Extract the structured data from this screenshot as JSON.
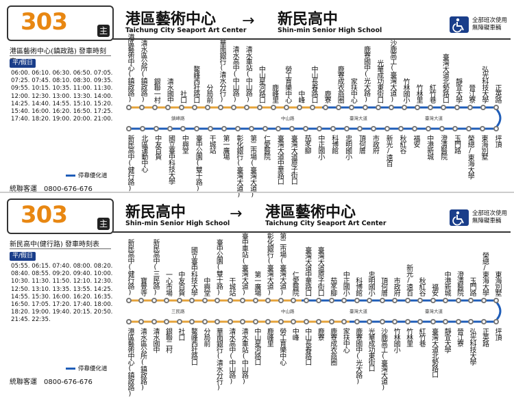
{
  "colors": {
    "route_number": "#e88712",
    "orange_line": "#e5a33a",
    "blue_line": "#1f5db8",
    "accent": "#1a3e8a"
  },
  "icons": {
    "main": "main-badge",
    "accessible": "wheelchair-icon"
  },
  "panels": [
    {
      "route": "303",
      "badge": "主",
      "from_zh": "港區藝術中心",
      "from_en": "Taichung City Seaport Art Center",
      "to_zh": "新民高中",
      "to_en": "Shin-min Senior High School",
      "arrow": "→",
      "access_text1": "全部班次使用",
      "access_text2": "無障礙車輛",
      "schedule_title": "港區藝術中心(鎮政路) 發車時刻表",
      "day_type": "平/假日",
      "times": [
        "06:00. 06:10. 06:30. 06:50. 07:05.",
        "07:25. 07:45. 08:10. 08:30. 09:35.",
        "09:55. 10:15. 10:35. 11:00. 11:30.",
        "12:00. 12:30. 13:00. 13:30. 14:00.",
        "14:25. 14:40. 14:55. 15:10. 15:20.",
        "15:40. 16:00. 16:20. 16:50. 17:25.",
        "17:40. 18:20. 19:00. 20:00. 21:00."
      ],
      "legend": "停靠優化道",
      "contact": "統聯客運　0800-676-676",
      "roads": [
        "鎮峰路",
        "中山路",
        "臺灣大道",
        "臺灣大道"
      ],
      "top_stops": [
        "港區藝術中心(鎮政路)",
        "清水區公所(鎮政路)",
        "銀聯一村",
        "清水國中",
        "社口",
        "鰲峰西社路口",
        "分局前",
        "華南銀行(清水分行)",
        "清水高中(中山路)",
        "清水車站(中山路)",
        "中山星河路口",
        "鹿峰里",
        "勞工育樂中心",
        "中峰",
        "中山長春路口",
        "鹿寮",
        "鹿寮成衣商圈",
        "家扶中心",
        "鹿寮國中(光大路)",
        "光華成功東街口",
        "沙鹿高工(臺灣大道)",
        "竹林國小",
        "竹林里",
        "紅竹巷",
        "臺灣大道北勢路口",
        "靜宜大學",
        "晉江寮",
        "弘光科技大學",
        "正英路"
      ],
      "bottom_stops": [
        "新民高中(健行路)",
        "北區運動中心",
        "中友百貨",
        "國立臺中科技大學",
        "中興堂",
        "臺中公園(雙十路)",
        "干城站",
        "第一廣場",
        "彰化銀行(臺灣大道)",
        "第二市場(臺灣大道)",
        "仁愛醫院",
        "臺灣大道中華路口",
        "臺灣大道原子街口",
        "茄苳腳",
        "中正國小",
        "科博館",
        "忠明國小",
        "頂何厝",
        "市政府",
        "新光/遠百",
        "秋紅谷",
        "福安",
        "中港新城",
        "澄清醫院",
        "玉門路",
        "榮總/東海大學",
        "東海別墅",
        "坪頂"
      ]
    },
    {
      "route": "303",
      "badge": "主",
      "from_zh": "新民高中",
      "from_en": "Shin-min Senior High School",
      "to_zh": "港區藝術中心",
      "to_en": "Taichung City Seaport Art Center",
      "arrow": "→",
      "access_text1": "全部班次使用",
      "access_text2": "無障礙車輛",
      "schedule_title": "新民高中(健行路) 發車時刻表",
      "day_type": "平/假日",
      "times": [
        "05:55. 06:15. 07:40. 08:00. 08:20.",
        "08:40. 08:55. 09:20. 09:40. 10:00.",
        "10:30. 11:30. 11:50. 12:10. 12:30.",
        "12:50. 13:10. 13:35. 13:55. 14:25.",
        "14:55. 15:30. 16:00. 16:20. 16:35.",
        "16:50. 17:05. 17:20. 17:40. 18:00.",
        "18:20. 19:00. 19:40. 20:15. 20:50.",
        "21:45. 22:35."
      ],
      "legend": "停靠優化道",
      "contact": "統聯客運　0800-676-676",
      "roads": [
        "三民路",
        "中山路",
        "臺灣大道",
        "臺灣大道"
      ],
      "top_stops": [
        "新民高中(健行路)",
        "寶覺寺",
        "新民高中(三民路)",
        "一心市場",
        "中友百貨",
        "國立臺中科技大學",
        "中興堂",
        "臺中公園(雙十路)",
        "干城站",
        "臺中車站(臺灣大道)",
        "第一廣場",
        "彰化銀行(臺灣大道)",
        "第二市場(臺灣大道)",
        "仁愛醫院",
        "臺灣大道中華路口",
        "臺灣大道原子街口",
        "茄苳腳",
        "中正國小",
        "科博館",
        "忠明國小",
        "頂何厝",
        "市政府",
        "新光/遠百",
        "秋紅谷",
        "福安",
        "中港新城",
        "澄清醫院",
        "玉門路",
        "榮總/東海大學",
        "東海別墅"
      ],
      "bottom_stops": [
        "港區藝術中心(鎮政路)",
        "清水區公所(鎮政路)",
        "清水國中",
        "銀聯二村",
        "社口",
        "鰲峰西社路口",
        "分局前",
        "華南銀行(清水分行)",
        "清水高中(中山路)",
        "清水車站(中山路)",
        "中山星河路口",
        "鹿峰里",
        "勞工育樂中心",
        "中峰",
        "中山長春路口",
        "鹿寮",
        "鹿寮成衣商圈",
        "家扶中心",
        "鹿寮國中(光大路)",
        "光華成功東街口",
        "沙鹿高工(臺灣大道)",
        "竹林國小",
        "竹林里",
        "紅竹巷",
        "臺灣大道北勢路口",
        "靜宜大學",
        "晉江寮",
        "弘光科技大學",
        "正英路",
        "坪頂"
      ]
    }
  ]
}
